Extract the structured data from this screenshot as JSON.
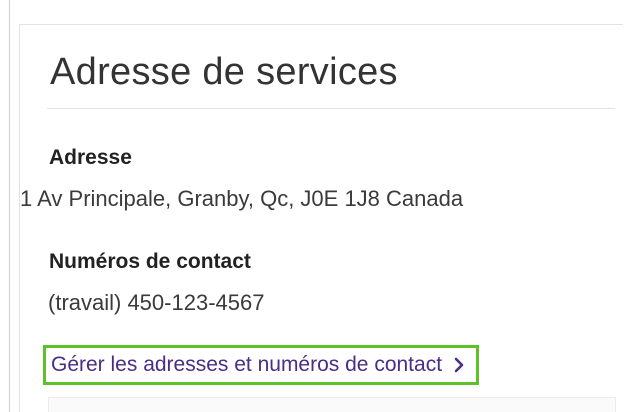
{
  "card": {
    "title": "Adresse de services",
    "address": {
      "label": "Adresse",
      "value": "1 Av Principale, Granby, Qc, J0E 1J8 Canada"
    },
    "contact": {
      "label": "Numéros de contact",
      "value": "(travail) 450-123-4567"
    },
    "manage_link": {
      "label": "Gérer les adresses et numéros de contact",
      "icon": "chevron-right-icon"
    }
  },
  "colors": {
    "link_text": "#4b2c86",
    "highlight_border": "#5ec12a",
    "title_text": "#333333"
  }
}
